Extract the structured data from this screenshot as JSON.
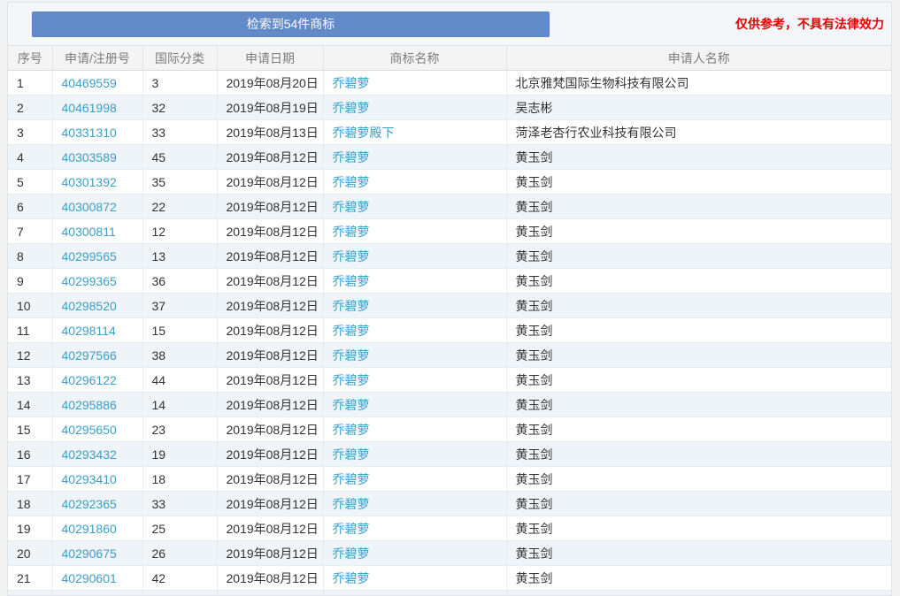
{
  "toolbar": {
    "result_button_label": "检索到54件商标",
    "disclaimer": "仅供参考，不具有法律效力"
  },
  "colors": {
    "button_blue": "#6289c8",
    "link_teal": "#3d9ec6",
    "disclaimer_red": "#e60000",
    "even_row_bg": "#eff4f9",
    "header_bg": "#f4f4f4"
  },
  "table": {
    "columns": [
      "序号",
      "申请/注册号",
      "国际分类",
      "申请日期",
      "商标名称",
      "申请人名称"
    ],
    "rows": [
      {
        "no": "1",
        "reg_no": "40469559",
        "intl_class": "3",
        "apply_date": "2019年08月20日",
        "trademark": "乔碧萝",
        "applicant": "北京雅梵国际生物科技有限公司"
      },
      {
        "no": "2",
        "reg_no": "40461998",
        "intl_class": "32",
        "apply_date": "2019年08月19日",
        "trademark": "乔碧萝",
        "applicant": "吴志彬"
      },
      {
        "no": "3",
        "reg_no": "40331310",
        "intl_class": "33",
        "apply_date": "2019年08月13日",
        "trademark": "乔碧萝殿下",
        "applicant": "菏泽老杏行农业科技有限公司"
      },
      {
        "no": "4",
        "reg_no": "40303589",
        "intl_class": "45",
        "apply_date": "2019年08月12日",
        "trademark": "乔碧萝",
        "applicant": "黄玉剑"
      },
      {
        "no": "5",
        "reg_no": "40301392",
        "intl_class": "35",
        "apply_date": "2019年08月12日",
        "trademark": "乔碧萝",
        "applicant": "黄玉剑"
      },
      {
        "no": "6",
        "reg_no": "40300872",
        "intl_class": "22",
        "apply_date": "2019年08月12日",
        "trademark": "乔碧萝",
        "applicant": "黄玉剑"
      },
      {
        "no": "7",
        "reg_no": "40300811",
        "intl_class": "12",
        "apply_date": "2019年08月12日",
        "trademark": "乔碧萝",
        "applicant": "黄玉剑"
      },
      {
        "no": "8",
        "reg_no": "40299565",
        "intl_class": "13",
        "apply_date": "2019年08月12日",
        "trademark": "乔碧萝",
        "applicant": "黄玉剑"
      },
      {
        "no": "9",
        "reg_no": "40299365",
        "intl_class": "36",
        "apply_date": "2019年08月12日",
        "trademark": "乔碧萝",
        "applicant": "黄玉剑"
      },
      {
        "no": "10",
        "reg_no": "40298520",
        "intl_class": "37",
        "apply_date": "2019年08月12日",
        "trademark": "乔碧萝",
        "applicant": "黄玉剑"
      },
      {
        "no": "11",
        "reg_no": "40298114",
        "intl_class": "15",
        "apply_date": "2019年08月12日",
        "trademark": "乔碧萝",
        "applicant": "黄玉剑"
      },
      {
        "no": "12",
        "reg_no": "40297566",
        "intl_class": "38",
        "apply_date": "2019年08月12日",
        "trademark": "乔碧萝",
        "applicant": "黄玉剑"
      },
      {
        "no": "13",
        "reg_no": "40296122",
        "intl_class": "44",
        "apply_date": "2019年08月12日",
        "trademark": "乔碧萝",
        "applicant": "黄玉剑"
      },
      {
        "no": "14",
        "reg_no": "40295886",
        "intl_class": "14",
        "apply_date": "2019年08月12日",
        "trademark": "乔碧萝",
        "applicant": "黄玉剑"
      },
      {
        "no": "15",
        "reg_no": "40295650",
        "intl_class": "23",
        "apply_date": "2019年08月12日",
        "trademark": "乔碧萝",
        "applicant": "黄玉剑"
      },
      {
        "no": "16",
        "reg_no": "40293432",
        "intl_class": "19",
        "apply_date": "2019年08月12日",
        "trademark": "乔碧萝",
        "applicant": "黄玉剑"
      },
      {
        "no": "17",
        "reg_no": "40293410",
        "intl_class": "18",
        "apply_date": "2019年08月12日",
        "trademark": "乔碧萝",
        "applicant": "黄玉剑"
      },
      {
        "no": "18",
        "reg_no": "40292365",
        "intl_class": "33",
        "apply_date": "2019年08月12日",
        "trademark": "乔碧萝",
        "applicant": "黄玉剑"
      },
      {
        "no": "19",
        "reg_no": "40291860",
        "intl_class": "25",
        "apply_date": "2019年08月12日",
        "trademark": "乔碧萝",
        "applicant": "黄玉剑"
      },
      {
        "no": "20",
        "reg_no": "40290675",
        "intl_class": "26",
        "apply_date": "2019年08月12日",
        "trademark": "乔碧萝",
        "applicant": "黄玉剑"
      },
      {
        "no": "21",
        "reg_no": "40290601",
        "intl_class": "42",
        "apply_date": "2019年08月12日",
        "trademark": "乔碧萝",
        "applicant": "黄玉剑"
      }
    ]
  }
}
